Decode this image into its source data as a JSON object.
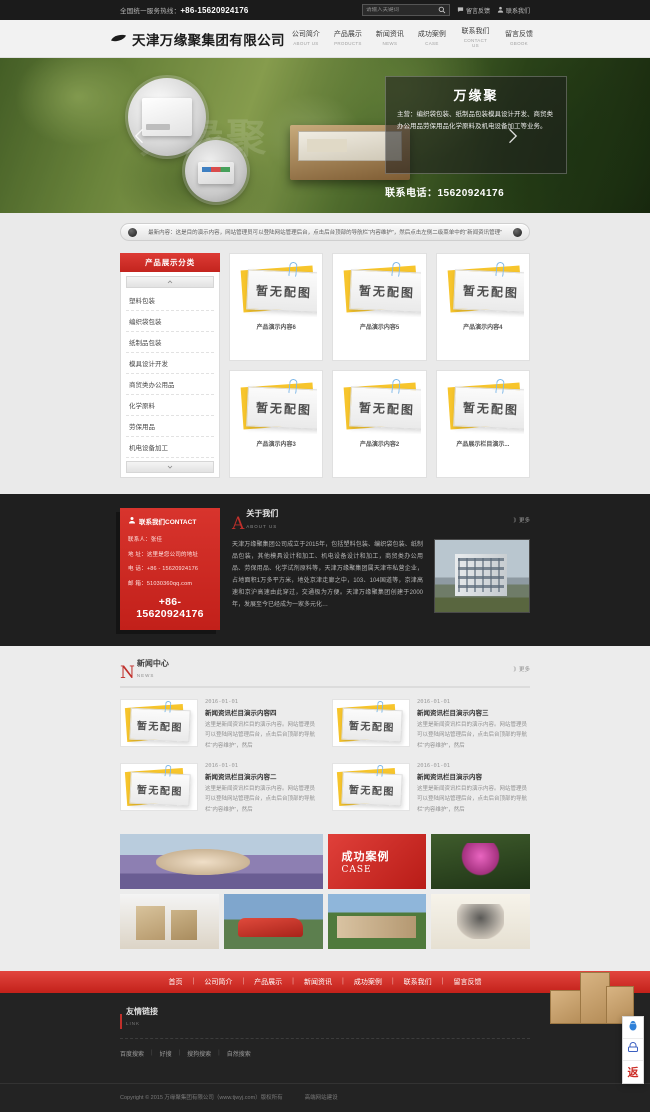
{
  "topbar": {
    "phone_label": "全国统一服务热线：",
    "phone_number": "+86-15620924176",
    "search_placeholder": "请输入关键词",
    "link_message": "留言反馈",
    "link_contact": "联系我们"
  },
  "header": {
    "logo_text": "天津万缘聚集团有限公司",
    "nav": [
      {
        "cn": "公司简介",
        "en": "ABOUT US"
      },
      {
        "cn": "产品展示",
        "en": "PRODUCTS"
      },
      {
        "cn": "新闻资讯",
        "en": "NEWS"
      },
      {
        "cn": "成功案例",
        "en": "CASE"
      },
      {
        "cn": "联系我们",
        "en": "CONTACT US"
      },
      {
        "cn": "留言反馈",
        "en": "GBOOK"
      }
    ]
  },
  "banner": {
    "ghost_text": "万缘聚",
    "title": "万缘聚",
    "description": "主营：编织袋包装、纸制品包装模具设计开发、商贸类办公用品劳保用品化学原料及机电设备加工等业务。",
    "phone_line": "联系电话：15620924176"
  },
  "notice": {
    "text": "最新内容：这是目的演示内容，网站管理员可以登陆网站管理后台，点击后台顶部的导航栏“内容维护”，然后点击左侧二级菜单中的“新闻资讯管理”"
  },
  "products": {
    "category_title": "产品展示分类",
    "categories": [
      "塑料包装",
      "编织袋包装",
      "纸制品包装",
      "模具设计开发",
      "商贸类办公用品",
      "化学原料",
      "劳保用品",
      "机电设备加工"
    ],
    "placeholder_word": "暂无配图",
    "items": [
      {
        "name": "产品演示内容6"
      },
      {
        "name": "产品演示内容5"
      },
      {
        "name": "产品演示内容4"
      },
      {
        "name": "产品演示内容3"
      },
      {
        "name": "产品演示内容2"
      },
      {
        "name": "产品展示栏目演示..."
      }
    ]
  },
  "contact": {
    "title": "联系我们CONTACT",
    "person": "联系人：张佳",
    "address": "地 址：这里是您公司的地址",
    "tel": "电 话：+86 - 15620924176",
    "email": "邮 箱：51030360qq.com",
    "big_phone": "+86-15620924176"
  },
  "about": {
    "letter": "A",
    "title_cn": "关于我们",
    "title_en": "ABOUT US",
    "more": "》更多",
    "text": "天津万缘聚集团公司成立于2015年，包括塑料包装、编织袋包装、纸制品包装，其他模具设计和加工、机电设备设计和加工，商贸类办公用品、劳保用品、化学试剂原料等，天津万缘聚集团属天津市私营企业，占地面积1万多平方米，地处京津走廊之中，103、104国道等，京津高速和京沪高速由此穿过，交通极为方便。天津万缘聚集团创建于2000年，发展至今已经成为一家多元化…"
  },
  "news": {
    "letter": "N",
    "title_cn": "新闻中心",
    "title_en": "NEWS",
    "more": "》更多",
    "placeholder_word": "暂无配图",
    "items": [
      {
        "date": "2016-01-01",
        "title": "新闻资讯栏目演示内容四",
        "desc": "这里是新闻资讯栏目的演示内容。网站管理员可以登陆网站管理后台，点击后台顶部的导航栏“内容维护”，然后"
      },
      {
        "date": "2016-01-01",
        "title": "新闻资讯栏目演示内容三",
        "desc": "这里是新闻资讯栏目的演示内容。网站管理员可以登陆网站管理后台，点击后台顶部的导航栏“内容维护”，然后"
      },
      {
        "date": "2016-01-01",
        "title": "新闻资讯栏目演示内容二",
        "desc": "这里是新闻资讯栏目的演示内容。网站管理员可以登陆网站管理后台，点击后台顶部的导航栏“内容维护”，然后"
      },
      {
        "date": "2016-01-01",
        "title": "新闻资讯栏目演示内容",
        "desc": "这里是新闻资讯栏目的演示内容。网站管理员可以登陆网站管理后台，点击后台顶部的导航栏“内容维护”，然后"
      }
    ]
  },
  "case": {
    "title_cn": "成功案例",
    "title_en": "CASE"
  },
  "footer": {
    "nav": [
      "首页",
      "公司简介",
      "产品展示",
      "新闻资讯",
      "成功案例",
      "联系我们",
      "留言反馈"
    ],
    "links_cn": "友情链接",
    "links_en": "LINK",
    "links": [
      "百度搜索",
      "好搜",
      "搜狗搜索",
      "自然搜索"
    ],
    "copyright": "Copyright © 2015 万缘聚集团有限公司（www.tjwyj.com）版权所有",
    "builder": "高端网站建设"
  },
  "side_tools": {
    "qq": "qq-icon",
    "phone": "telephone-icon",
    "top": "返"
  },
  "colors": {
    "brand_red": "#c3211a",
    "dark": "#1f1f1f",
    "topbar": "#1b1b1b"
  }
}
